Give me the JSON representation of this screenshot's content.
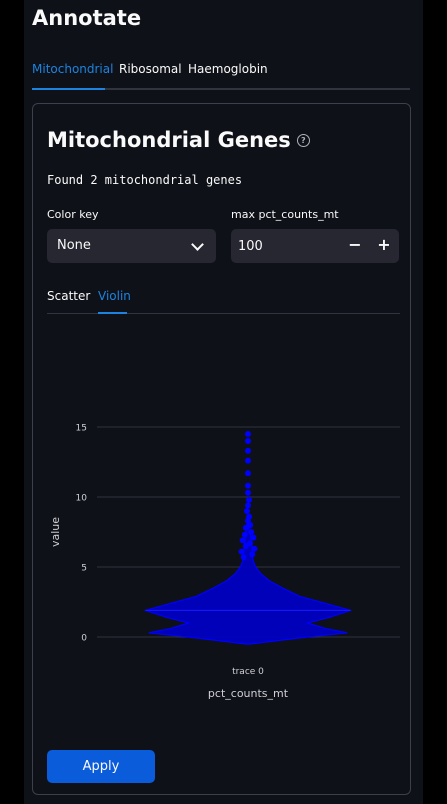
{
  "page": {
    "title": "Annotate"
  },
  "tabs": [
    {
      "label": "Mitochondrial",
      "active": true
    },
    {
      "label": "Ribosomal",
      "active": false
    },
    {
      "label": "Haemoglobin",
      "active": false
    }
  ],
  "card": {
    "title": "Mitochondrial Genes",
    "help_icon": "question-circle-icon",
    "status": "Found 2 mitochondrial genes",
    "color_key": {
      "label": "Color key",
      "value": "None"
    },
    "max_pct": {
      "label": "max pct_counts_mt",
      "value": "100",
      "decrement": "−",
      "increment": "+"
    },
    "subtabs": [
      {
        "label": "Scatter",
        "active": false
      },
      {
        "label": "Violin",
        "active": true
      }
    ],
    "apply_label": "Apply"
  },
  "colors": {
    "accent": "#1c83e1",
    "violin": "#0000ff",
    "button": "#0b5cdb"
  },
  "chart_data": {
    "type": "violin",
    "ylabel": "value",
    "xlabel": "pct_counts_mt",
    "categories": [
      "trace 0"
    ],
    "yticks": [
      0,
      5,
      10,
      15
    ],
    "ylim": [
      -0.5,
      15
    ],
    "grid": true,
    "density": [
      {
        "y": -0.5,
        "w": 0.02
      },
      {
        "y": 0.0,
        "w": 0.55
      },
      {
        "y": 0.3,
        "w": 0.92
      },
      {
        "y": 0.6,
        "w": 0.72
      },
      {
        "y": 1.0,
        "w": 0.55
      },
      {
        "y": 1.4,
        "w": 0.75
      },
      {
        "y": 1.9,
        "w": 0.95
      },
      {
        "y": 2.4,
        "w": 0.72
      },
      {
        "y": 2.9,
        "w": 0.48
      },
      {
        "y": 3.5,
        "w": 0.32
      },
      {
        "y": 4.0,
        "w": 0.2
      },
      {
        "y": 4.5,
        "w": 0.12
      },
      {
        "y": 5.0,
        "w": 0.07
      },
      {
        "y": 5.5,
        "w": 0.045
      },
      {
        "y": 6.5,
        "w": 0.035
      },
      {
        "y": 7.5,
        "w": 0.02
      },
      {
        "y": 8.5,
        "w": 0.0
      }
    ],
    "outliers": [
      {
        "x": -0.04,
        "y": 5.7
      },
      {
        "x": 0.04,
        "y": 5.9
      },
      {
        "x": -0.06,
        "y": 6.1
      },
      {
        "x": 0.06,
        "y": 6.3
      },
      {
        "x": -0.02,
        "y": 6.5
      },
      {
        "x": 0.02,
        "y": 6.7
      },
      {
        "x": -0.05,
        "y": 6.9
      },
      {
        "x": 0.05,
        "y": 7.1
      },
      {
        "x": -0.03,
        "y": 7.3
      },
      {
        "x": 0.03,
        "y": 7.5
      },
      {
        "x": -0.02,
        "y": 7.8
      },
      {
        "x": 0.02,
        "y": 8.0
      },
      {
        "x": 0.0,
        "y": 8.3
      },
      {
        "x": 0.01,
        "y": 8.6
      },
      {
        "x": -0.01,
        "y": 9.0
      },
      {
        "x": 0.0,
        "y": 9.4
      },
      {
        "x": 0.01,
        "y": 9.8
      },
      {
        "x": 0.0,
        "y": 10.3
      },
      {
        "x": 0.0,
        "y": 10.8
      },
      {
        "x": 0.0,
        "y": 11.7
      },
      {
        "x": 0.0,
        "y": 12.6
      },
      {
        "x": 0.0,
        "y": 13.3
      },
      {
        "x": 0.0,
        "y": 14.0
      },
      {
        "x": 0.0,
        "y": 14.5
      }
    ]
  }
}
